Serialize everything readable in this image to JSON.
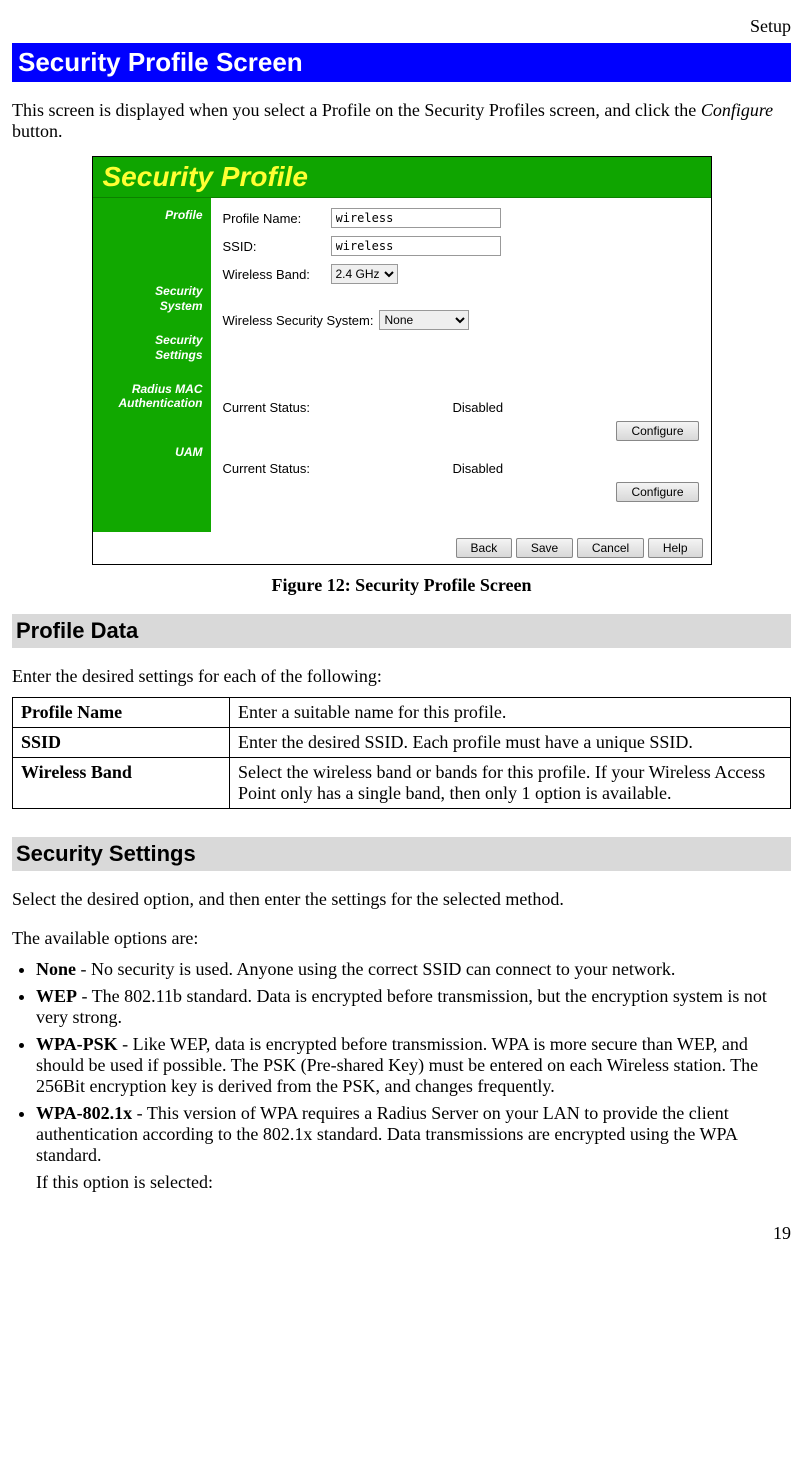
{
  "header": "Setup",
  "title": "Security Profile Screen",
  "intro": {
    "p1a": "This screen is displayed when you select a Profile on the Security Profiles screen, and click the ",
    "p1b": "Configure",
    "p1c": " button."
  },
  "screenshot": {
    "title": "Security Profile",
    "sidebar": {
      "profile": "Profile",
      "security_system_a": "Security",
      "security_system_b": "System",
      "security_settings_a": "Security",
      "security_settings_b": "Settings",
      "radius_a": "Radius MAC",
      "radius_b": "Authentication",
      "uam": "UAM"
    },
    "profile": {
      "name_label": "Profile Name:",
      "name_value": "wireless",
      "ssid_label": "SSID:",
      "ssid_value": "wireless",
      "band_label": "Wireless Band:",
      "band_value": "2.4 GHz"
    },
    "security_system": {
      "label": "Wireless Security System:",
      "value": "None"
    },
    "radius": {
      "status_label": "Current Status:",
      "status_value": "Disabled",
      "configure": "Configure"
    },
    "uam": {
      "status_label": "Current Status:",
      "status_value": "Disabled",
      "configure": "Configure"
    },
    "buttons": {
      "back": "Back",
      "save": "Save",
      "cancel": "Cancel",
      "help": "Help"
    }
  },
  "figure_caption": "Figure 12: Security Profile Screen",
  "profile_data": {
    "heading": "Profile Data",
    "intro": "Enter the desired settings for each of the following:",
    "rows": [
      {
        "key": "Profile Name",
        "val": "Enter a suitable name for this profile."
      },
      {
        "key": "SSID",
        "val": "Enter the desired SSID. Each profile must have a unique SSID."
      },
      {
        "key": "Wireless Band",
        "val": "Select the wireless band or bands for this profile. If your Wireless Access Point only has a single band, then only 1 option is available."
      }
    ]
  },
  "security_settings": {
    "heading": "Security Settings",
    "intro1": "Select the desired option, and then enter the settings for the selected method.",
    "intro2": "The available options are:",
    "items": {
      "none": {
        "label": "None",
        "text": " - No security is used. Anyone using the correct SSID can connect to your network."
      },
      "wep": {
        "label": "WEP",
        "text": " - The 802.11b standard. Data is encrypted before transmission, but the encryption system is not very strong."
      },
      "wpapsk": {
        "label": "WPA-PSK",
        "text": " - Like WEP, data is encrypted before transmission. WPA is more secure than WEP, and should be used if possible. The PSK (Pre-shared Key) must be entered on each Wireless station. The 256Bit encryption key is derived from the PSK, and changes frequently."
      },
      "wpa8021x": {
        "label": "WPA-802.1x",
        "text": " - This version of WPA requires a Radius Server on your LAN to provide the client authentication according to the 802.1x standard. Data transmissions are encrypted using the WPA standard.",
        "sub": "If this option is selected:"
      }
    }
  },
  "page_number": "19"
}
